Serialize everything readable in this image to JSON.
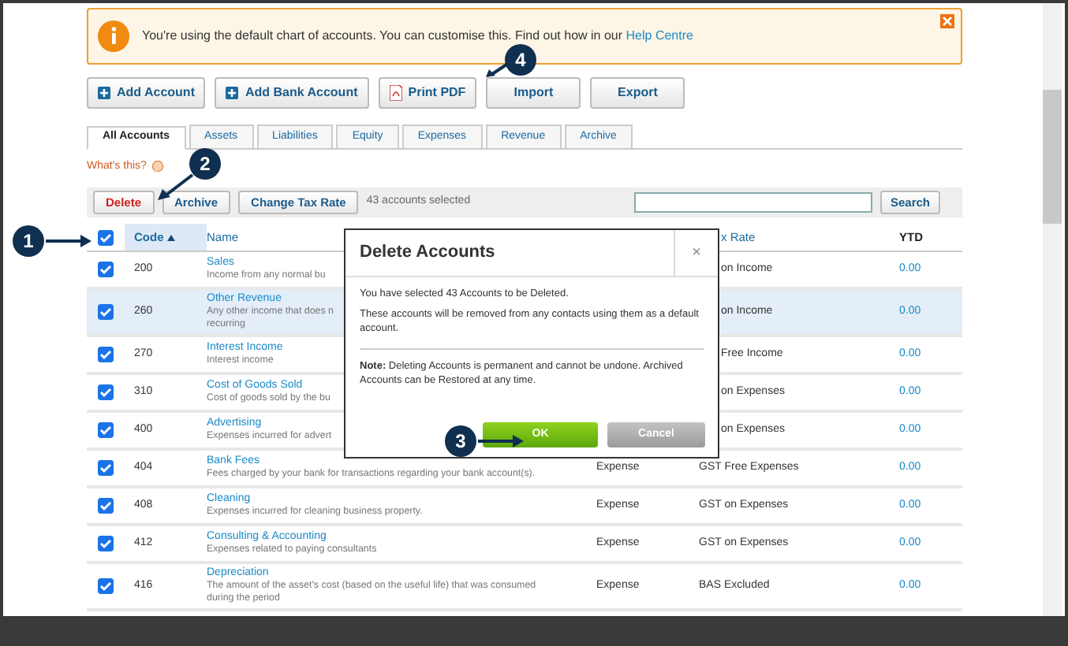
{
  "banner": {
    "message": "You're using the default chart of accounts. You can customise this. Find out how in our ",
    "link": "Help Centre"
  },
  "actions": [
    {
      "label": "Add Account",
      "kind": "plus"
    },
    {
      "label": "Add Bank Account",
      "kind": "plus"
    },
    {
      "label": "Print PDF",
      "kind": "pdf"
    },
    {
      "label": "Import",
      "kind": "plain"
    },
    {
      "label": "Export",
      "kind": "plain"
    }
  ],
  "tabs": [
    {
      "label": "All Accounts",
      "selected": true
    },
    {
      "label": "Assets",
      "selected": false
    },
    {
      "label": "Liabilities",
      "selected": false
    },
    {
      "label": "Equity",
      "selected": false
    },
    {
      "label": "Expenses",
      "selected": false
    },
    {
      "label": "Revenue",
      "selected": false
    },
    {
      "label": "Archive",
      "selected": false
    }
  ],
  "whats_this": "What's this?",
  "toolbar": {
    "buttons": [
      {
        "label": "Delete",
        "kind": "danger"
      },
      {
        "label": "Archive",
        "kind": "normal"
      },
      {
        "label": "Change Tax Rate",
        "kind": "normal"
      }
    ],
    "status": "43 accounts selected",
    "search_button": "Search"
  },
  "table": {
    "all_checked": true,
    "columns": [
      {
        "label": "Code",
        "sorted": true
      },
      {
        "label": "Name",
        "sorted": false
      },
      {
        "label": "x Rate",
        "sorted": false
      },
      {
        "label": "YTD",
        "sorted": false
      }
    ],
    "rows": [
      {
        "checked": true,
        "selected": false,
        "code": "200",
        "name": "Sales",
        "description": "Income from any normal bu",
        "tax_rate": "on Income",
        "ytd": "0.00"
      },
      {
        "checked": true,
        "selected": true,
        "code": "260",
        "name": "Other Revenue",
        "description": "Any other income that does n",
        "description_2": "recurring",
        "tax_rate": "on Income",
        "ytd": "0.00"
      },
      {
        "checked": true,
        "selected": false,
        "code": "270",
        "name": "Interest Income",
        "description": "Interest income",
        "tax_rate": "Free Income",
        "ytd": "0.00"
      },
      {
        "checked": true,
        "selected": false,
        "code": "310",
        "name": "Cost of Goods Sold",
        "description": "Cost of goods sold by the bu",
        "tax_rate": "on Expenses",
        "ytd": "0.00"
      },
      {
        "checked": true,
        "selected": false,
        "code": "400",
        "name": "Advertising",
        "description": "Expenses incurred for advert",
        "tax_rate": "on Expenses",
        "ytd": "0.00"
      },
      {
        "checked": true,
        "selected": false,
        "code": "404",
        "name": "Bank Fees",
        "description": "Fees charged by your bank for transactions regarding your bank account(s).",
        "type": "Expense",
        "tax_rate": "GST Free Expenses",
        "ytd": "0.00"
      },
      {
        "checked": true,
        "selected": false,
        "code": "408",
        "name": "Cleaning",
        "description": "Expenses incurred for cleaning business property.",
        "type": "Expense",
        "tax_rate": "GST on Expenses",
        "ytd": "0.00"
      },
      {
        "checked": true,
        "selected": false,
        "code": "412",
        "name": "Consulting & Accounting",
        "description": "Expenses related to paying consultants",
        "type": "Expense",
        "tax_rate": "GST on Expenses",
        "ytd": "0.00"
      },
      {
        "checked": true,
        "selected": false,
        "code": "416",
        "name": "Depreciation",
        "description": "The amount of the asset's cost (based on the useful life) that was consumed",
        "description_2": "during the period",
        "type": "Expense",
        "tax_rate": "BAS Excluded",
        "ytd": "0.00"
      }
    ]
  },
  "dialog": {
    "title": "Delete Accounts",
    "close": "×",
    "paragraphs": [
      "You have selected 43 Accounts to be Deleted.",
      "These accounts will be removed from any contacts using them as a default account."
    ],
    "note_label": "Note:",
    "note": " Deleting Accounts is permanent and cannot be undone. Archived Accounts can be Restored at any time.",
    "ok": "OK",
    "cancel": "Cancel"
  },
  "callouts": [
    {
      "number": "1"
    },
    {
      "number": "2"
    },
    {
      "number": "3"
    },
    {
      "number": "4"
    }
  ]
}
